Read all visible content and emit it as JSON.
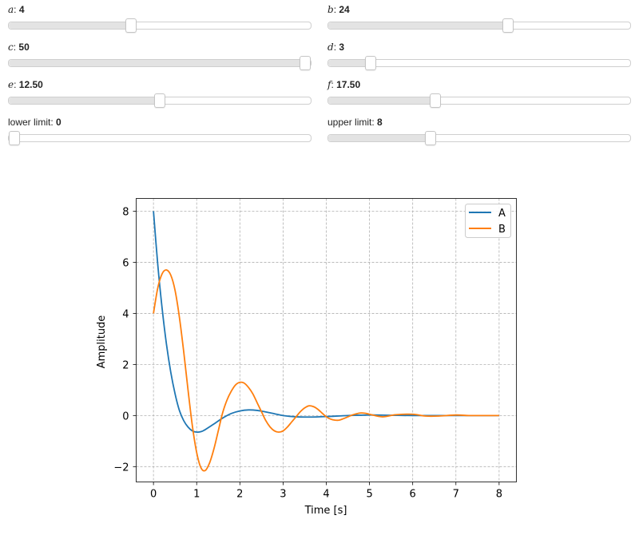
{
  "controls": [
    {
      "var": "a",
      "value": "4",
      "min": 0,
      "max": 10,
      "v": 4
    },
    {
      "var": "b",
      "value": "24",
      "min": 0,
      "max": 40,
      "v": 24
    },
    {
      "var": "c",
      "value": "50",
      "min": 0,
      "max": 50,
      "v": 50
    },
    {
      "var": "d",
      "value": "3",
      "min": 0,
      "max": 24,
      "v": 3
    },
    {
      "var": "e",
      "value": "12.50",
      "min": 0,
      "max": 25,
      "v": 12.5
    },
    {
      "var": "f",
      "value": "17.50",
      "min": 0,
      "max": 50,
      "v": 17.5
    },
    {
      "var": "",
      "label": "lower limit",
      "value": "0",
      "min": 0,
      "max": 24,
      "v": 0
    },
    {
      "var": "",
      "label": "upper limit",
      "value": "8",
      "min": 0,
      "max": 24,
      "v": 8
    }
  ],
  "chart_data": {
    "type": "line",
    "xlabel": "Time [s]",
    "ylabel": "Amplitude",
    "xlim": [
      -0.4,
      8.4
    ],
    "ylim": [
      -2.6,
      8.5
    ],
    "xticks": [
      0,
      1,
      2,
      3,
      4,
      5,
      6,
      7,
      8
    ],
    "yticks": [
      -2,
      0,
      2,
      4,
      6,
      8
    ],
    "ytick_labels": [
      "−2",
      "0",
      "2",
      "4",
      "6",
      "8"
    ],
    "grid": true,
    "legend": "top-right",
    "series": [
      {
        "name": "A",
        "color": "#1f77b4",
        "x": [
          0,
          0.1,
          0.2,
          0.3,
          0.4,
          0.5,
          0.6,
          0.7,
          0.8,
          0.9,
          1.0,
          1.1,
          1.2,
          1.4,
          1.6,
          1.8,
          2.0,
          2.2,
          2.4,
          2.6,
          2.8,
          3.0,
          3.3,
          3.6,
          4.0,
          4.5,
          5.0,
          5.5,
          6.0,
          7.0,
          8.0
        ],
        "y": [
          8.0,
          5.9,
          4.2,
          2.8,
          1.7,
          0.85,
          0.2,
          -0.2,
          -0.45,
          -0.6,
          -0.65,
          -0.63,
          -0.55,
          -0.33,
          -0.1,
          0.08,
          0.18,
          0.22,
          0.2,
          0.14,
          0.07,
          0.0,
          -0.05,
          -0.06,
          -0.04,
          0.0,
          0.02,
          0.01,
          0.0,
          0.0,
          0.0
        ]
      },
      {
        "name": "B",
        "color": "#ff7f0e",
        "x": [
          0,
          0.1,
          0.2,
          0.3,
          0.4,
          0.5,
          0.6,
          0.7,
          0.8,
          0.9,
          1.0,
          1.1,
          1.2,
          1.3,
          1.4,
          1.5,
          1.6,
          1.7,
          1.8,
          1.9,
          2.0,
          2.1,
          2.2,
          2.3,
          2.4,
          2.5,
          2.6,
          2.7,
          2.8,
          2.9,
          3.0,
          3.1,
          3.2,
          3.3,
          3.4,
          3.5,
          3.6,
          3.7,
          3.8,
          3.9,
          4.0,
          4.1,
          4.2,
          4.3,
          4.4,
          4.5,
          4.6,
          4.7,
          4.8,
          4.9,
          5.0,
          5.3,
          5.6,
          6.0,
          6.3,
          6.6,
          7.0,
          7.3,
          7.6,
          8.0
        ],
        "y": [
          4.0,
          5.0,
          5.55,
          5.7,
          5.5,
          4.9,
          3.85,
          2.5,
          1.0,
          -0.4,
          -1.45,
          -2.05,
          -2.15,
          -1.85,
          -1.3,
          -0.6,
          0.1,
          0.6,
          0.95,
          1.2,
          1.3,
          1.27,
          1.1,
          0.85,
          0.5,
          0.15,
          -0.2,
          -0.45,
          -0.6,
          -0.65,
          -0.6,
          -0.45,
          -0.25,
          -0.05,
          0.15,
          0.3,
          0.38,
          0.35,
          0.25,
          0.1,
          -0.05,
          -0.14,
          -0.18,
          -0.18,
          -0.12,
          -0.05,
          0.02,
          0.07,
          0.1,
          0.09,
          0.05,
          -0.05,
          0.03,
          0.05,
          -0.02,
          -0.02,
          0.02,
          0.0,
          0.0,
          0.0
        ]
      }
    ]
  }
}
